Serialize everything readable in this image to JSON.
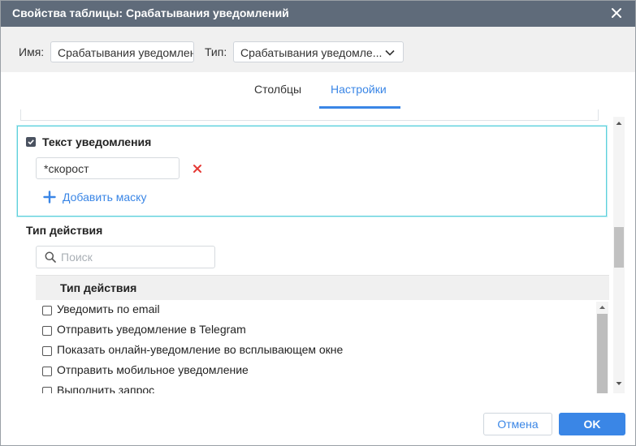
{
  "dialog": {
    "title": "Свойства таблицы: Срабатывания уведомлений"
  },
  "header": {
    "name_label": "Имя:",
    "name_value": "Срабатывания уведомлений",
    "type_label": "Тип:",
    "type_value": "Срабатывания уведомле..."
  },
  "tabs": [
    {
      "label": "Столбцы",
      "active": false
    },
    {
      "label": "Настройки",
      "active": true
    }
  ],
  "notification_text": {
    "title": "Текст уведомления",
    "checked": true,
    "mask_value": "*скорост",
    "add_mask_label": "Добавить маску"
  },
  "action_type": {
    "title": "Тип действия",
    "search_placeholder": "Поиск",
    "column_header": "Тип действия",
    "items": [
      {
        "label": "Уведомить по email",
        "checked": false
      },
      {
        "label": "Отправить уведомление в Telegram",
        "checked": false
      },
      {
        "label": "Показать онлайн-уведомление во всплывающем окне",
        "checked": false
      },
      {
        "label": "Отправить мобильное уведомление",
        "checked": false
      },
      {
        "label": "Выполнить запрос",
        "checked": false
      }
    ]
  },
  "footer": {
    "cancel_label": "Отмена",
    "ok_label": "OK"
  },
  "colors": {
    "titlebar": "#5f6b7a",
    "accent": "#3a86e6",
    "highlight_border": "#5dd0db",
    "delete": "#e53935"
  },
  "icons": [
    "close-icon",
    "chevron-down-icon",
    "checkbox-icon",
    "delete-icon",
    "plus-icon",
    "search-icon"
  ]
}
